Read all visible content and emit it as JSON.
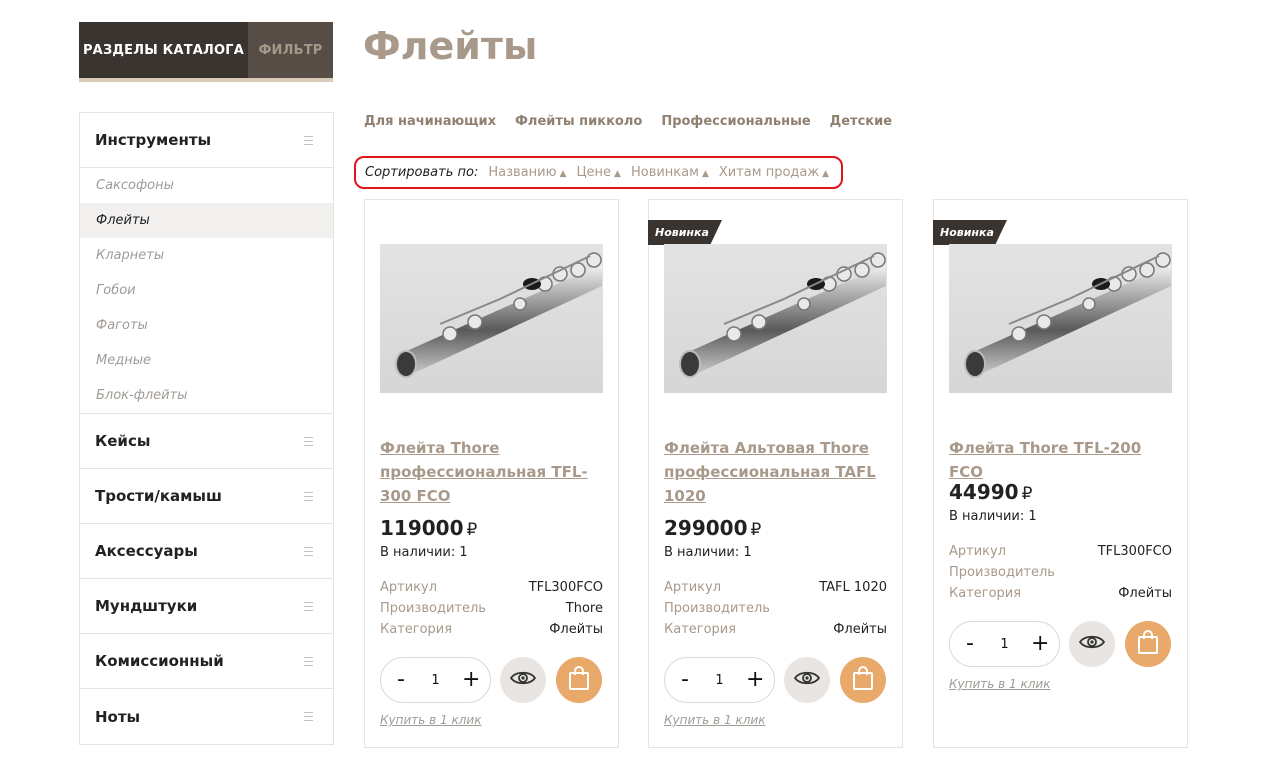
{
  "sidebar": {
    "tabs": [
      {
        "label": "РАЗДЕЛЫ КАТАЛОГА"
      },
      {
        "label": "ФИЛЬТР"
      }
    ],
    "categories": [
      {
        "label": "Инструменты"
      },
      {
        "label": "Кейсы"
      },
      {
        "label": "Трости/камыш"
      },
      {
        "label": "Аксессуары"
      },
      {
        "label": "Мундштуки"
      },
      {
        "label": "Комиссионный"
      },
      {
        "label": "Ноты"
      }
    ],
    "subcategories": [
      {
        "label": "Саксофоны"
      },
      {
        "label": "Флейты"
      },
      {
        "label": "Кларнеты"
      },
      {
        "label": "Гобои"
      },
      {
        "label": "Фаготы"
      },
      {
        "label": "Медные"
      },
      {
        "label": "Блок-флейты"
      }
    ]
  },
  "page": {
    "title": "Флейты",
    "subcategory_links": [
      {
        "label": "Для начинающих"
      },
      {
        "label": "Флейты пикколо"
      },
      {
        "label": "Профессиональные"
      },
      {
        "label": "Детские"
      }
    ],
    "sort": {
      "label": "Сортировать по:",
      "options": [
        {
          "label": "Названию"
        },
        {
          "label": "Цене"
        },
        {
          "label": "Новинкам"
        },
        {
          "label": "Хитам продаж"
        }
      ],
      "arrow": "▲"
    }
  },
  "products": [
    {
      "badge": "",
      "name": "Флейта Thore профессиональная TFL-300 FCO",
      "price": "119000",
      "currency": "₽",
      "stock": "В наличии: 1",
      "props": [
        {
          "key": "Артикул",
          "value": "TFL300FCO"
        },
        {
          "key": "Производитель",
          "value": "Thore"
        },
        {
          "key": "Категория",
          "value": "Флейты"
        }
      ],
      "qty": "1",
      "minus": "-",
      "plus": "+",
      "oneclick": "Купить в 1 клик"
    },
    {
      "badge": "Новинка",
      "name": "Флейта Альтовая Thore профессиональная TAFL 1020",
      "price": "299000",
      "currency": "₽",
      "stock": "В наличии: 1",
      "props": [
        {
          "key": "Артикул",
          "value": "TAFL 1020"
        },
        {
          "key": "Производитель",
          "value": ""
        },
        {
          "key": "Категория",
          "value": "Флейты"
        }
      ],
      "qty": "1",
      "minus": "-",
      "plus": "+",
      "oneclick": "Купить в 1 клик"
    },
    {
      "badge": "Новинка",
      "name": "Флейта Thore TFL-200 FCO",
      "price": "44990",
      "currency": "₽",
      "stock": "В наличии: 1",
      "props": [
        {
          "key": "Артикул",
          "value": "TFL300FCO"
        },
        {
          "key": "Производитель",
          "value": ""
        },
        {
          "key": "Категория",
          "value": "Флейты"
        }
      ],
      "qty": "1",
      "minus": "-",
      "plus": "+",
      "oneclick": "Купить в 1 клик"
    }
  ],
  "icons": {
    "category_toggle": "hamburger-icon",
    "quick_view": "eye-icon",
    "cart": "shopping-bag-icon"
  },
  "colors": {
    "accent_tan": "#a8998a",
    "dark_brown": "#3a3431",
    "cart_orange": "#e9a96a",
    "highlight_red": "#e0141b"
  }
}
